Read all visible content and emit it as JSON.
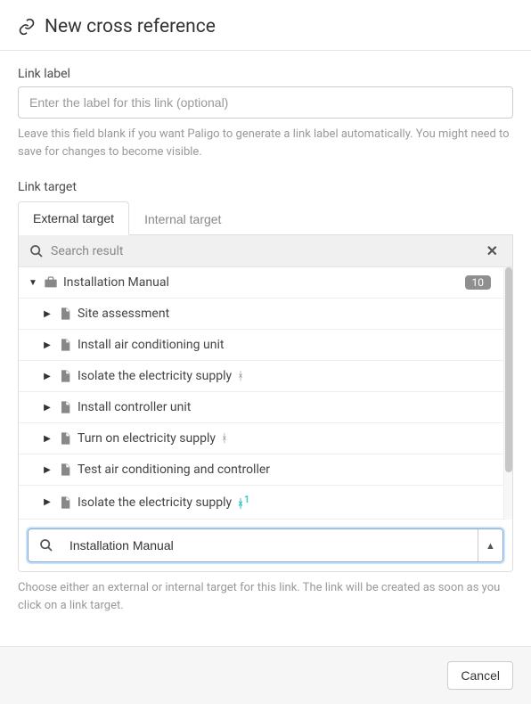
{
  "header": {
    "title": "New cross reference"
  },
  "link_label": {
    "label": "Link label",
    "placeholder": "Enter the label for this link (optional)",
    "value": "",
    "help": "Leave this field blank if you want Paligo to generate a link label automatically. You might need to save for changes to become visible."
  },
  "link_target": {
    "label": "Link target",
    "tabs": {
      "external": "External target",
      "internal": "Internal target"
    },
    "search_header_text": "Search result",
    "tree": {
      "root": {
        "label": "Installation Manual",
        "count": "10"
      },
      "children": [
        {
          "label": "Site assessment",
          "branch": false
        },
        {
          "label": "Install air conditioning unit",
          "branch": false
        },
        {
          "label": "Isolate the electricity supply",
          "branch": true,
          "branch_accent": false
        },
        {
          "label": "Install controller unit",
          "branch": false
        },
        {
          "label": "Turn on electricity supply",
          "branch": true,
          "branch_accent": false
        },
        {
          "label": "Test air conditioning and controller",
          "branch": false
        },
        {
          "label": "Isolate the electricity supply",
          "branch": true,
          "branch_accent": true,
          "branch_suffix": "1"
        }
      ]
    },
    "search_value": "Installation Manual",
    "help": "Choose either an external or internal target for this link. The link will be created as soon as you click on a link target."
  },
  "footer": {
    "cancel": "Cancel"
  }
}
